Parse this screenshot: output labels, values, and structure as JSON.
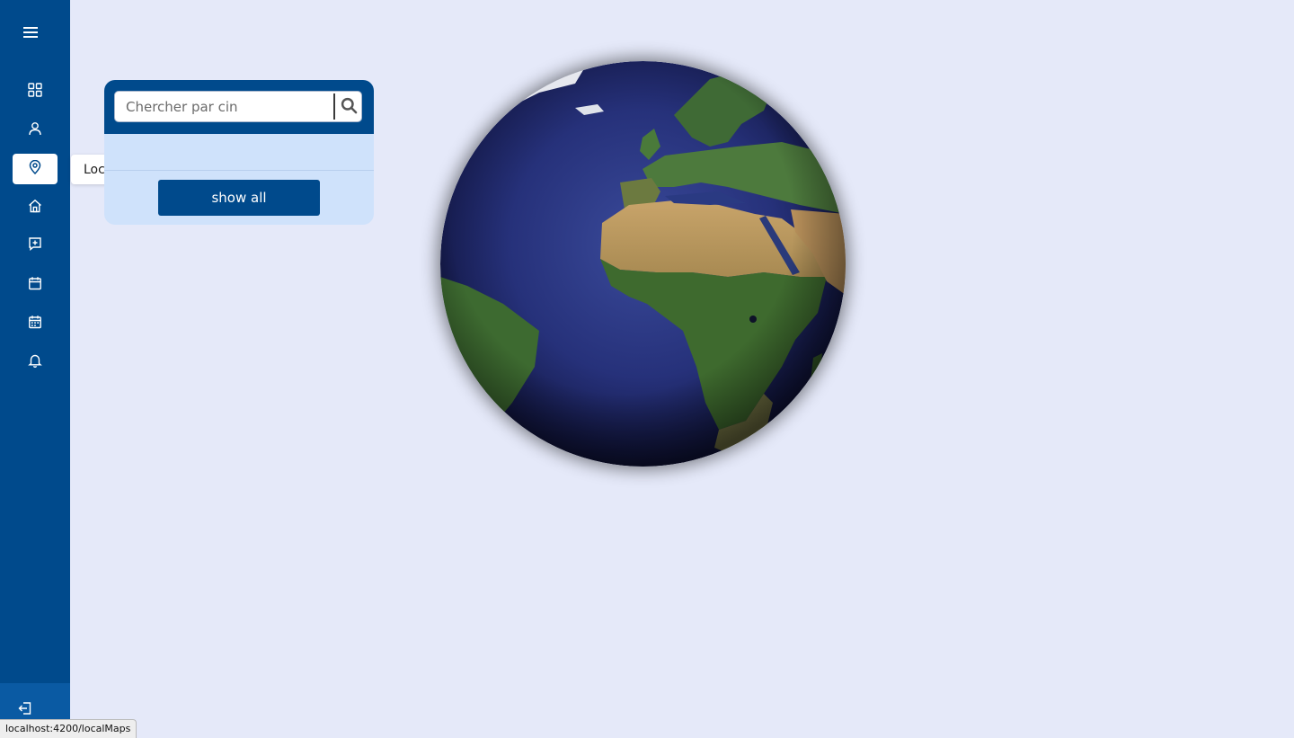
{
  "sidebar": {
    "background": "#004a8c",
    "menu_icon": "menu-icon",
    "items": [
      {
        "name": "dashboard",
        "icon": "grid-icon",
        "active": false
      },
      {
        "name": "users",
        "icon": "user-icon",
        "active": false
      },
      {
        "name": "local-maps",
        "icon": "map-pin-icon",
        "active": true
      },
      {
        "name": "home",
        "icon": "home-icon",
        "active": false
      },
      {
        "name": "medical",
        "icon": "medical-plus-icon",
        "active": false
      },
      {
        "name": "calendar",
        "icon": "calendar-icon",
        "active": false
      },
      {
        "name": "schedule",
        "icon": "calendar-days-icon",
        "active": false
      },
      {
        "name": "notifications",
        "icon": "bell-icon",
        "active": false
      }
    ],
    "logout_icon": "logout-icon"
  },
  "tooltip": {
    "text": "Local Maps"
  },
  "search": {
    "placeholder": "Chercher par cin",
    "value": "",
    "icon": "search-icon"
  },
  "panel": {
    "show_all_label": "show all"
  },
  "globe": {
    "icon": "earth-globe-image"
  },
  "status_bar": {
    "url": "localhost:4200/localMaps"
  },
  "colors": {
    "primary": "#004a8c",
    "background": "#e5e9f9",
    "panel_body": "#cfe2fb"
  }
}
